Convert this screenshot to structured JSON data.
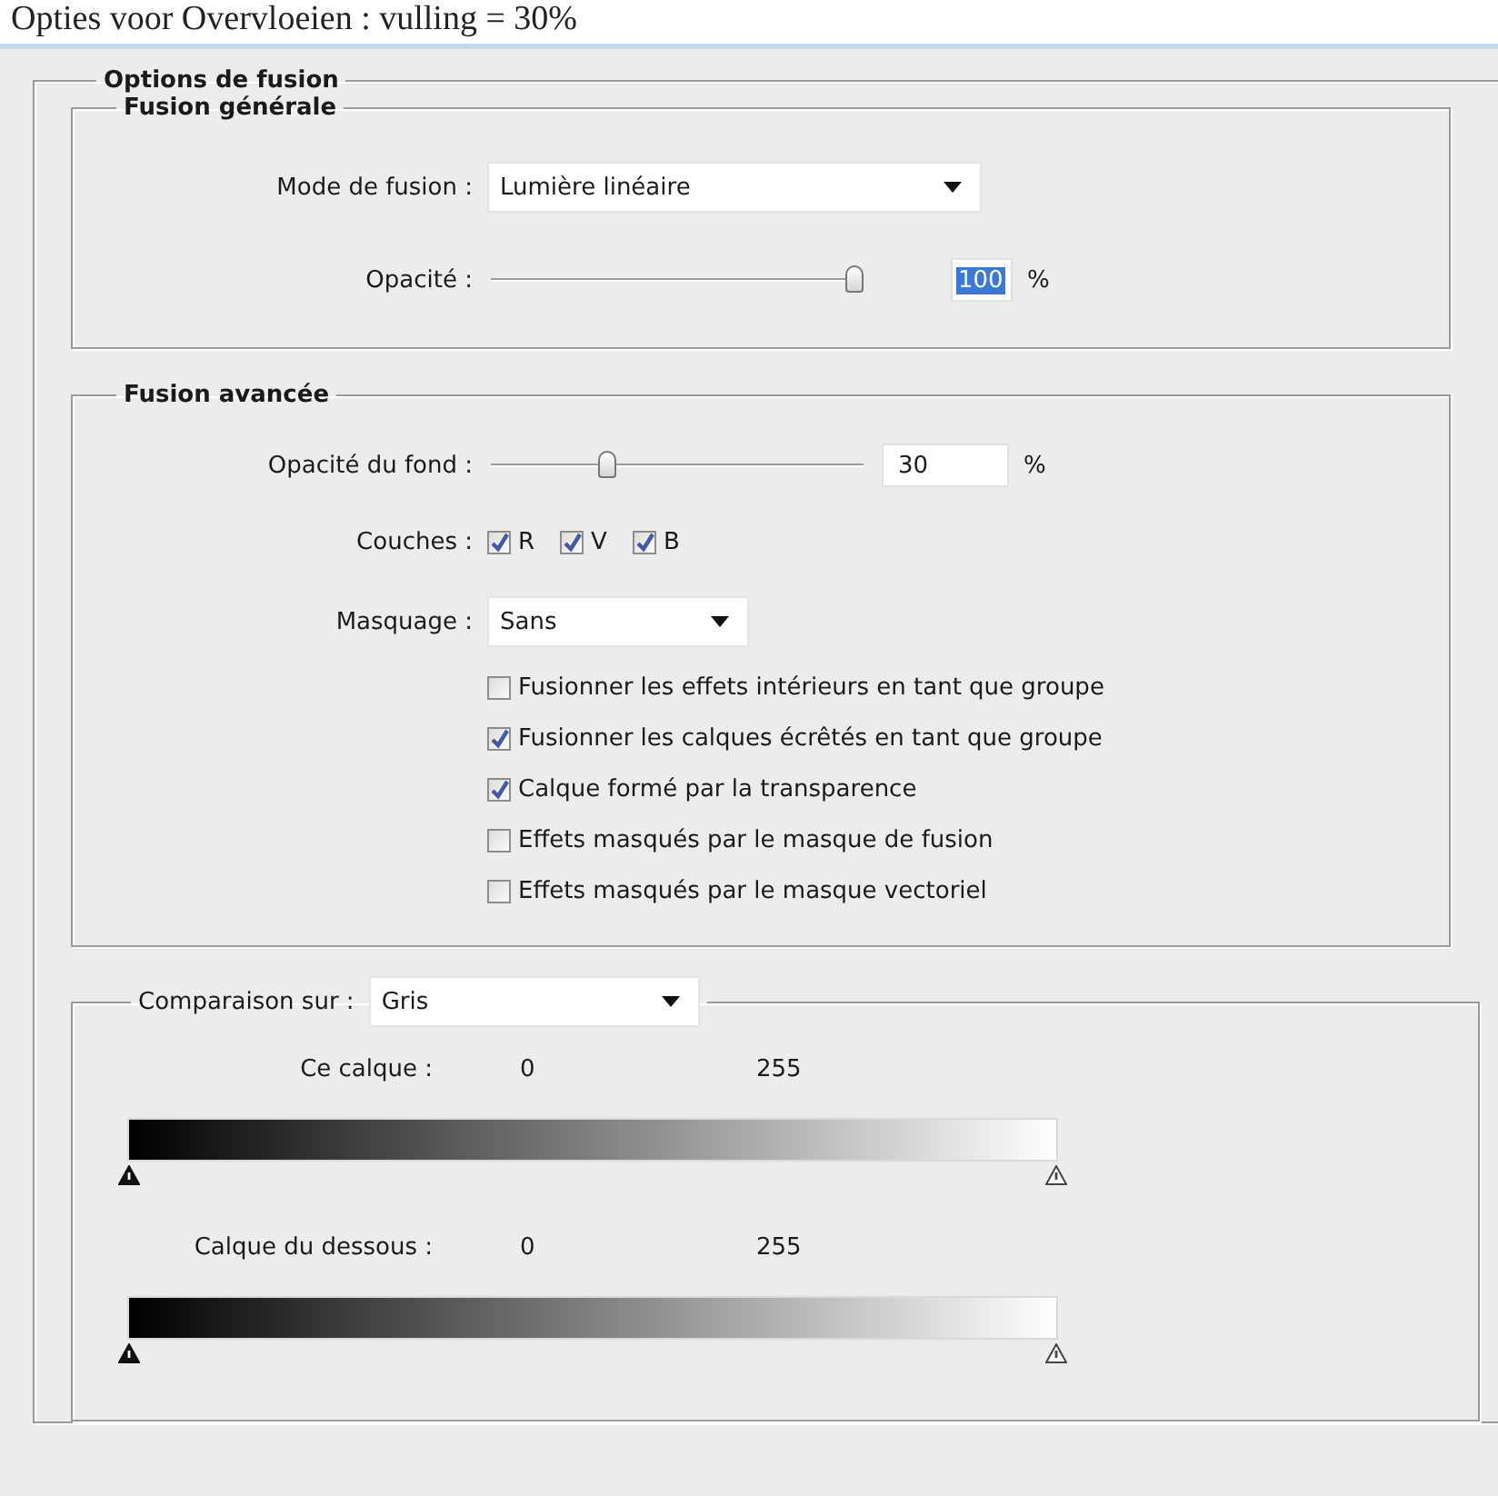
{
  "caption": "Opties voor Overvloeien : vulling = 30%",
  "blending_options": {
    "title": "Options de fusion",
    "general_blending": {
      "title": "Fusion générale",
      "blend_mode": {
        "label": "Mode de fusion :",
        "value": "Lumière linéaire"
      },
      "opacity": {
        "label": "Opacité :",
        "level": 1,
        "value": "100",
        "unit": "%",
        "selected": true
      }
    },
    "advanced_blending": {
      "title": "Fusion avancée",
      "fill_opacity": {
        "label": "Opacité du fond :",
        "level": 0.3,
        "value": "30",
        "unit": "%",
        "selected": false
      },
      "channels": {
        "label": "Couches :",
        "items": [
          {
            "label": "R",
            "checked": true
          },
          {
            "label": "V",
            "checked": true
          },
          {
            "label": "B",
            "checked": true
          }
        ]
      },
      "knockout": {
        "label": "Masquage :",
        "value": "Sans"
      },
      "options": [
        {
          "label": "Fusionner les effets intérieurs en tant que groupe",
          "checked": false
        },
        {
          "label": "Fusionner les calques écrêtés en tant que groupe",
          "checked": true
        },
        {
          "label": "Calque formé par la transparence",
          "checked": true
        },
        {
          "label": "Effets masqués par le masque de fusion",
          "checked": false
        },
        {
          "label": "Effets masqués par le masque vectoriel",
          "checked": false
        }
      ]
    },
    "blend_if": {
      "label": "Comparaison sur :",
      "value": "Gris",
      "ranges": [
        {
          "label": "Ce calque :",
          "min": "0",
          "max": "255"
        },
        {
          "label": "Calque du dessous :",
          "min": "0",
          "max": "255"
        }
      ]
    }
  }
}
